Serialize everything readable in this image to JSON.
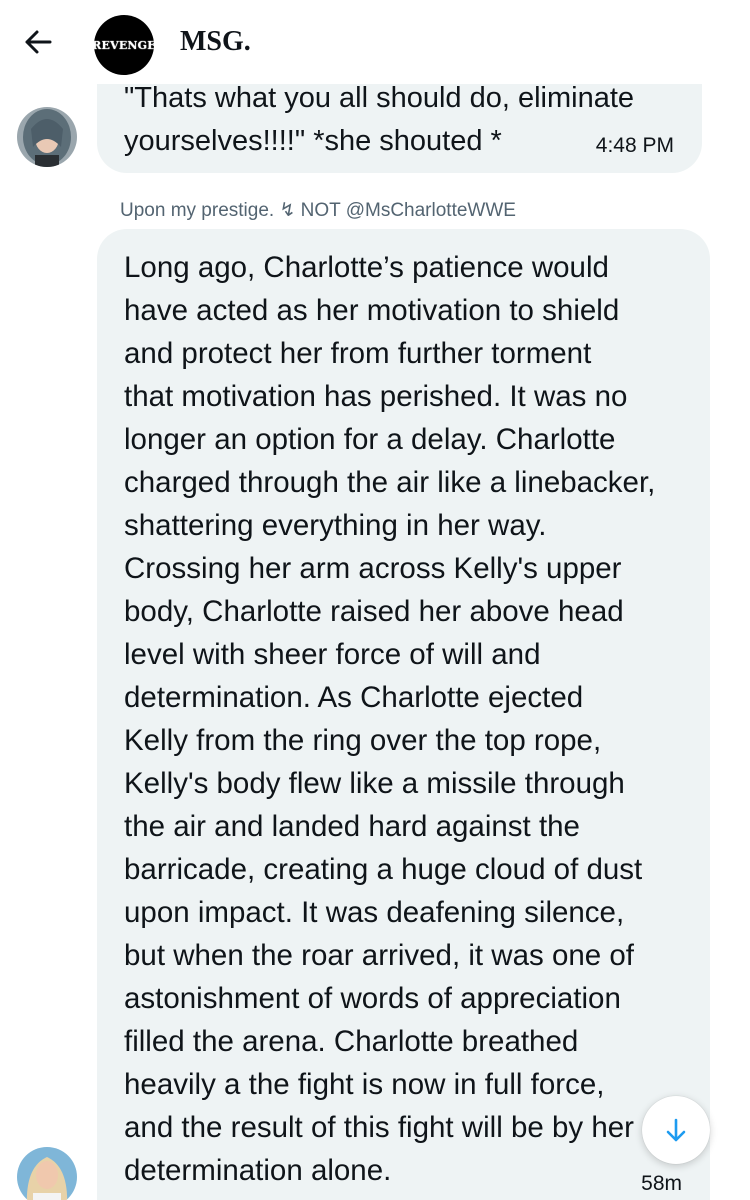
{
  "header": {
    "title": "MSG.",
    "avatar_logo_text": "REVENGE",
    "back_icon": "arrow-left-icon"
  },
  "messages": [
    {
      "text": "\"Thats what you all should do, eliminate\nyourselves!!!!\" *she shouted *",
      "time": "4:48 PM"
    },
    {
      "sender": "Upon my prestige. ↯ NOT @MsCharlotteWWE",
      "text": "Long ago, Charlotte’s patience would\nhave acted as her motivation to shield\nand protect her from further torment\nthat motivation has perished. It was no\nlonger an option for a delay. Charlotte\ncharged through the air like a linebacker,\nshattering everything in her way.\nCrossing her arm across Kelly's upper\nbody, Charlotte raised her above head\nlevel with sheer force of will and\ndetermination. As Charlotte ejected\nKelly from the ring over the top rope,\nKelly's body flew like a missile through\nthe air and landed hard against the\nbarricade, creating a huge cloud of dust\nupon impact. It was deafening silence,\nbut when the roar arrived, it was one of\nastonishment of words of appreciation\nfilled the arena. Charlotte breathed\nheavily a the fight is now in full force,\nand the result of this fight will be by her\ndetermination alone.",
      "time": "58m"
    }
  ],
  "scroll_button": {
    "icon": "arrow-down-icon",
    "color": "#1d9bf0"
  },
  "colors": {
    "bubble_bg": "#eef3f4",
    "text": "#0f1419",
    "muted": "#536471",
    "accent": "#1d9bf0"
  }
}
